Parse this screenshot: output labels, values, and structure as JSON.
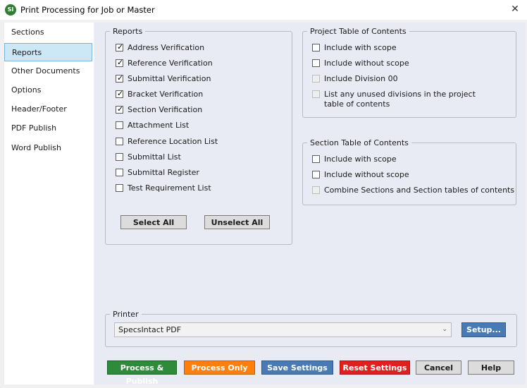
{
  "window": {
    "title": "Print Processing for Job or Master",
    "icon_text": "SI"
  },
  "sidebar": {
    "items": [
      {
        "label": "Sections"
      },
      {
        "label": "Reports",
        "selected": true
      },
      {
        "label": "Other Documents"
      },
      {
        "label": "Options"
      },
      {
        "label": "Header/Footer"
      },
      {
        "label": "PDF Publish"
      },
      {
        "label": "Word Publish"
      }
    ]
  },
  "reports": {
    "legend": "Reports",
    "items": [
      {
        "label": "Address Verification",
        "checked": true
      },
      {
        "label": "Reference Verification",
        "checked": true
      },
      {
        "label": "Submittal Verification",
        "checked": true
      },
      {
        "label": "Bracket Verification",
        "checked": true
      },
      {
        "label": "Section Verification",
        "checked": true
      },
      {
        "label": "Attachment List",
        "checked": false
      },
      {
        "label": "Reference Location List",
        "checked": false
      },
      {
        "label": "Submittal List",
        "checked": false
      },
      {
        "label": "Submittal Register",
        "checked": false
      },
      {
        "label": "Test Requirement List",
        "checked": false
      }
    ],
    "select_all": "Select All",
    "unselect_all": "Unselect All"
  },
  "project_toc": {
    "legend": "Project Table of Contents",
    "items": [
      {
        "label": "Include with scope",
        "checked": false,
        "enabled": true
      },
      {
        "label": "Include without scope",
        "checked": false,
        "enabled": true
      },
      {
        "label": "Include Division 00",
        "checked": false,
        "enabled": false
      },
      {
        "label": "List any unused divisions in the project table of contents",
        "checked": false,
        "enabled": false
      }
    ]
  },
  "section_toc": {
    "legend": "Section Table of Contents",
    "items": [
      {
        "label": "Include with scope",
        "checked": false,
        "enabled": true
      },
      {
        "label": "Include without scope",
        "checked": false,
        "enabled": true
      },
      {
        "label": "Combine Sections and Section tables of contents",
        "checked": false,
        "enabled": false
      }
    ]
  },
  "printer": {
    "legend": "Printer",
    "selected": "SpecsIntact PDF",
    "setup_label": "Setup..."
  },
  "footer": {
    "process_publish": "Process & Publish",
    "process_only": "Process Only",
    "save_settings": "Save Settings",
    "reset_settings": "Reset Settings",
    "cancel": "Cancel",
    "help": "Help"
  },
  "colors": {
    "accent_green": "#2e8b3a",
    "accent_orange": "#ff7f0e",
    "accent_blue": "#4a7ab4",
    "accent_red": "#e01f1f",
    "selection": "#cce8f7"
  }
}
